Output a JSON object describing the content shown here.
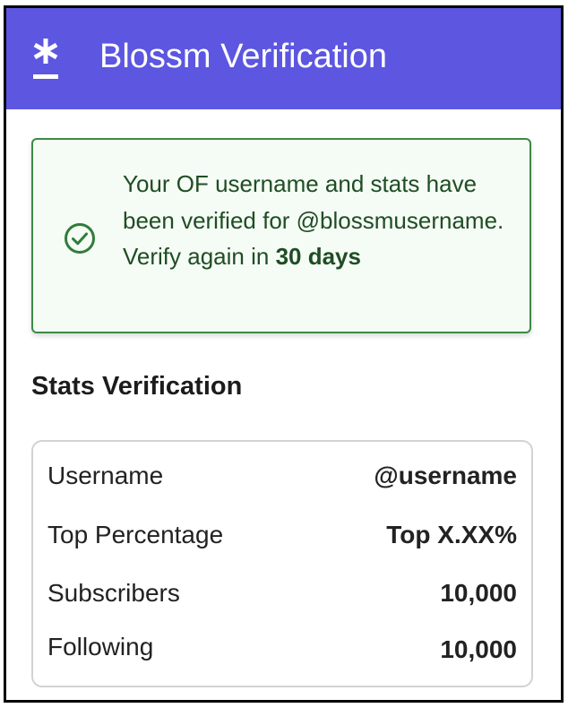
{
  "header": {
    "title": "Blossm Verification",
    "logo_icon": "asterisk-logo-icon",
    "background_color": "#5c56e0"
  },
  "banner": {
    "icon": "check-circle-icon",
    "text_prefix": "Your OF username and stats have been verified for @blossmusername. Verify again in ",
    "text_bold": "30 days",
    "border_color": "#3c8a46"
  },
  "stats": {
    "title": "Stats Verification",
    "rows": [
      {
        "label": "Username",
        "value": "@username"
      },
      {
        "label": "Top Percentage",
        "value": "Top X.XX%"
      },
      {
        "label": "Subscribers",
        "value": "10,000"
      },
      {
        "label": "Following",
        "value": "10,000"
      }
    ]
  }
}
